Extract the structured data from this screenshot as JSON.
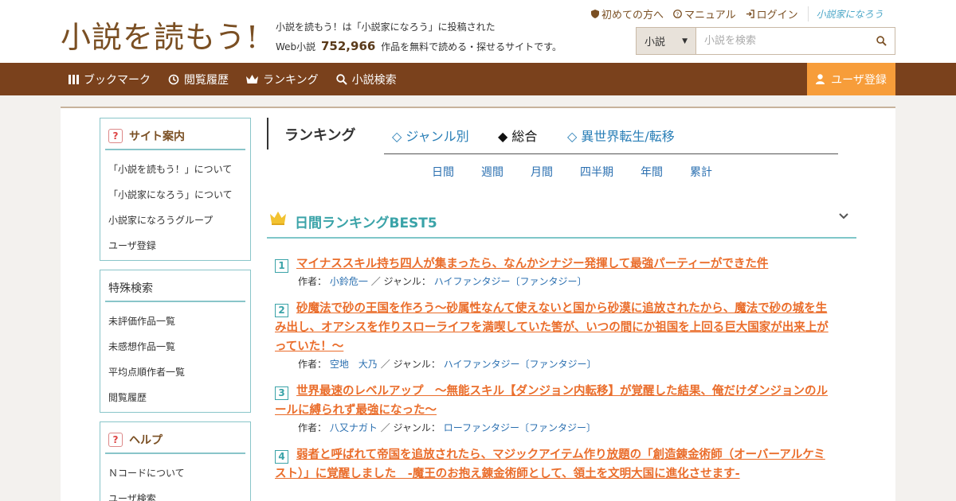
{
  "header": {
    "logo": "小説を読もう!",
    "tagline_line1": "小説を読もう！は「小説家になろう」に投稿された",
    "tagline_prefix": "Web小説",
    "tagline_count": "752,966",
    "tagline_suffix": "作品を無料で読める・探せるサイトです。",
    "toplinks": {
      "beginner": "初めての方へ",
      "manual": "マニュアル",
      "login": "ログイン",
      "brand": "小説家になろう"
    },
    "search": {
      "select_value": "小説",
      "placeholder": "小説を検索"
    }
  },
  "nav": {
    "items": [
      {
        "label": "ブックマーク",
        "icon": "bookmark-icon"
      },
      {
        "label": "閲覧履歴",
        "icon": "history-icon"
      },
      {
        "label": "ランキング",
        "icon": "crown-icon"
      },
      {
        "label": "小説検索",
        "icon": "search-icon"
      }
    ],
    "register": "ユーザ登録"
  },
  "sidebar": {
    "site_guide": {
      "title": "サイト案内",
      "items": [
        "「小説を読もう！」について",
        "「小説家になろう」について",
        "小説家になろうグループ",
        "ユーザ登録"
      ]
    },
    "special_search": {
      "title": "特殊検索",
      "items": [
        "未評価作品一覧",
        "未感想作品一覧",
        "平均点順作者一覧",
        "閲覧履歴"
      ]
    },
    "help": {
      "title": "ヘルプ",
      "items": [
        "Ｎコードについて",
        "ユーザ検索"
      ]
    }
  },
  "ranking": {
    "heading": "ランキング",
    "tabs": [
      "◇ ジャンル別",
      "◆ 総合",
      "◇ 異世界転生/転移"
    ],
    "periods": [
      "日間",
      "週間",
      "月間",
      "四半期",
      "年間",
      "累計"
    ],
    "best_title": "日間ランキングBEST5",
    "author_label": "作者：",
    "genre_label": "／ ジャンル：",
    "entries": [
      {
        "rank": "1",
        "title_lines": [
          "マイナススキル持ち四人が集まったら、なんかシナジー発揮して最強パーティーができた件"
        ],
        "author": "小鈴危一",
        "genre": "ハイファンタジー〔ファンタジー〕"
      },
      {
        "rank": "2",
        "title_lines": [
          "砂魔法で砂の王国を作ろう～砂属性なんて使えないと国から砂漠に追放されたから、魔法で砂の城を生",
          "み出し、オアシスを作りスローライフを満喫していた筈が、いつの間にか祖国を上回る巨大国家が出来上が",
          "っていた！～"
        ],
        "author": "空地　大乃",
        "genre": "ハイファンタジー〔ファンタジー〕"
      },
      {
        "rank": "3",
        "title_lines": [
          "世界最速のレベルアップ　～無能スキル【ダンジョン内転移】が覚醒した結果、俺だけダンジョンのル",
          "ールに縛られず最強になった～"
        ],
        "author": "八又ナガト",
        "genre": "ローファンタジー〔ファンタジー〕"
      },
      {
        "rank": "4",
        "title_lines": [
          "弱者と呼ばれて帝国を追放されたら、マジックアイテム作り放題の「創造錬金術師（オーバーアルケミ",
          "スト）」に覚醒しました　-魔王のお抱え錬金術師として、領土を文明大国に進化させます-"
        ],
        "author": "",
        "genre": ""
      }
    ]
  },
  "colors": {
    "brand_brown": "#7a411c",
    "accent_orange": "#f79d3a",
    "title_orange": "#ea6d2b",
    "teal": "#3aa3a8",
    "link_blue": "#2a6fb0"
  }
}
